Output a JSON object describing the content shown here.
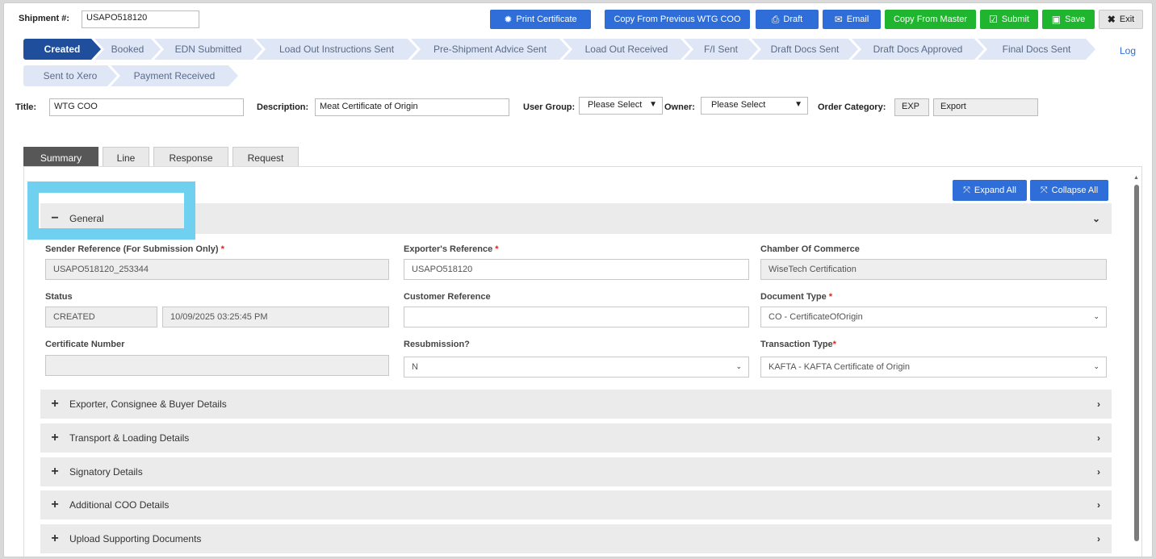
{
  "header": {
    "shipment_label": "Shipment #:",
    "shipment_value": "USAPO518120",
    "buttons": {
      "print": "Print Certificate",
      "copy_prev": "Copy From Previous WTG COO",
      "draft": "Draft",
      "email": "Email",
      "copy_master": "Copy From Master",
      "submit": "Submit",
      "save": "Save",
      "exit": "Exit"
    }
  },
  "steps": [
    "Created",
    "Booked",
    "EDN Submitted",
    "Load Out Instructions Sent",
    "Pre-Shipment Advice Sent",
    "Load Out Received",
    "F/I Sent",
    "Draft Docs Sent",
    "Draft Docs Approved",
    "Final Docs Sent",
    "Sent to Xero",
    "Payment Received"
  ],
  "log_label": "Log",
  "meta": {
    "title_label": "Title:",
    "title_value": "WTG COO",
    "description_label": "Description:",
    "description_value": "Meat Certificate of Origin",
    "user_group_label": "User Group:",
    "user_group_value": "Please Select",
    "owner_label": "Owner:",
    "owner_value": "Please Select",
    "order_category_label": "Order Category:",
    "order_category_code": "EXP",
    "order_category_name": "Export"
  },
  "tabs": [
    "Summary",
    "Line",
    "Response",
    "Request"
  ],
  "panel": {
    "expand_all": "Expand All",
    "collapse_all": "Collapse All",
    "general_title": "General",
    "fields": {
      "sender_ref_label": "Sender Reference (For Submission Only)",
      "sender_ref_value": "USAPO518120_253344",
      "exporter_ref_label": "Exporter's Reference",
      "exporter_ref_value": "USAPO518120",
      "chamber_label": "Chamber Of Commerce",
      "chamber_value": "WiseTech Certification",
      "status_label": "Status",
      "status_value": "CREATED",
      "status_date": "10/09/2025 03:25:45 PM",
      "customer_ref_label": "Customer Reference",
      "customer_ref_value": "",
      "doc_type_label": "Document Type",
      "doc_type_value": "CO - CertificateOfOrigin",
      "cert_number_label": "Certificate Number",
      "cert_number_value": "",
      "resubmission_label": "Resubmission?",
      "resubmission_value": "N",
      "transaction_type_label": "Transaction Type",
      "transaction_type_value": "KAFTA - KAFTA Certificate of Origin"
    },
    "sections": [
      "Exporter, Consignee & Buyer Details",
      "Transport & Loading Details",
      "Signatory Details",
      "Additional COO Details",
      "Upload Supporting Documents"
    ]
  },
  "colors": {
    "primary": "#2f6ed8",
    "success": "#20b52e",
    "active_step": "#1f4f9c",
    "step": "#dfe6f6",
    "highlight": "#6fd1ef"
  }
}
